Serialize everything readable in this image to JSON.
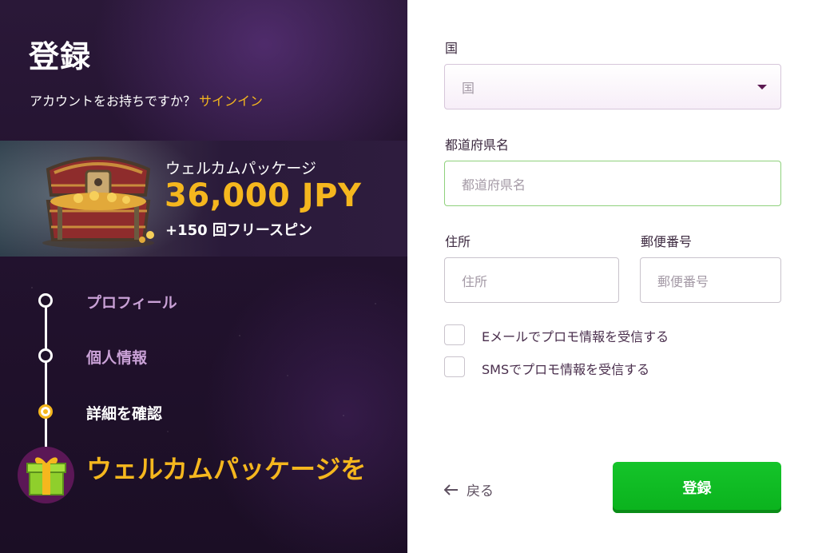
{
  "left": {
    "title": "登録",
    "have_account_text": "アカウントをお持ちですか？",
    "signin_link": "サインイン",
    "promo": {
      "title": "ウェルカムパッケージ",
      "amount": "36,000 JPY",
      "spins": "+150 回フリースピン"
    },
    "steps": [
      {
        "label": "プロフィール",
        "state": "done"
      },
      {
        "label": "個人情報",
        "state": "done"
      },
      {
        "label": "詳細を確認",
        "state": "current"
      }
    ],
    "welcome_text": "ウェルカムパッケージを"
  },
  "form": {
    "country": {
      "label": "国",
      "placeholder": "国"
    },
    "prefecture": {
      "label": "都道府県名",
      "placeholder": "都道府県名"
    },
    "address": {
      "label": "住所",
      "placeholder": "住所"
    },
    "postal": {
      "label": "郵便番号",
      "placeholder": "郵便番号"
    },
    "email_promo": "Eメールでプロモ情報を受信する",
    "sms_promo": "SMSでプロモ情報を受信する",
    "back_label": "戻る",
    "submit_label": "登録"
  },
  "colors": {
    "accent_gold": "#f5b71e",
    "submit_green": "#0ab21d",
    "panel_purple": "#22122e"
  },
  "icons": [
    "chevron-down-icon",
    "arrow-left-icon",
    "treasure-chest-icon",
    "gift-icon"
  ]
}
